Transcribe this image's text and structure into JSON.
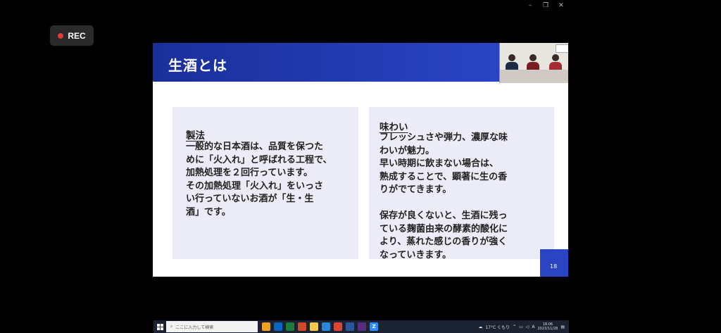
{
  "recording": {
    "label": "REC"
  },
  "slide": {
    "title": "生酒とは",
    "page_number": "18",
    "left_panel": {
      "heading": "製法",
      "body": "一般的な日本酒は、品質を保つた\nめに「火入れ」と呼ばれる工程で、\n加熱処理を２回行っています。\nその加熱処理「火入れ」をいっさ\nい行っていないお酒が「生・生\n酒」です。"
    },
    "right_panel": {
      "heading": "味わい",
      "body": "フレッシュさや弾力、濃厚な味\nわいが魅力。\n早い時期に飲まない場合は、\n熟成することで、顕著に生の香\nりがでてきます。\n\n保存が良くないと、生酒に残っ\nている麹菌由来の酵素的酸化に\nより、蒸れた感じの香りが強く\nなっていきます。"
    }
  },
  "taskbar": {
    "search_placeholder": "ここに入力して検索",
    "weather": "17°C くもり",
    "ime": "A",
    "time": "18:06",
    "date": "2023/11/28"
  },
  "colors": {
    "header_blue": "#2a44c4",
    "panel_bg": "#ececf8",
    "rec_dot": "#e0393b"
  }
}
